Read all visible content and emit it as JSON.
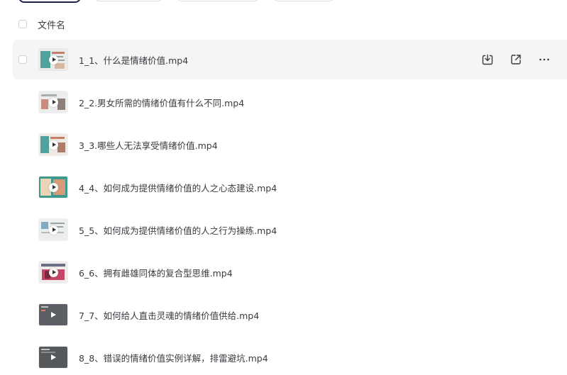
{
  "header": {
    "column_label": "文件名"
  },
  "files": [
    {
      "name": "1_1、什么是情绪价值.mp4",
      "thumb": "light",
      "hovered": true
    },
    {
      "name": "2_2.男女所需的情绪价值有什么不同.mp4",
      "thumb": "light"
    },
    {
      "name": "3_3.哪些人无法享受情绪价值.mp4",
      "thumb": "light"
    },
    {
      "name": "4_4、如何成为提供情绪价值的人之心态建设.mp4",
      "thumb": "teal"
    },
    {
      "name": "5_5、如何成为提供情绪价值的人之行为操练.mp4",
      "thumb": "light"
    },
    {
      "name": "6_6、拥有雌雄同体的复合型思维.mp4",
      "thumb": "pink"
    },
    {
      "name": "7_7、如何给人直击灵魂的情绪价值供给.mp4",
      "thumb": "dark"
    },
    {
      "name": "8_8、错误的情绪价值实例详解，排雷避坑.mp4",
      "thumb": "dark"
    }
  ],
  "row_actions": [
    "download-icon",
    "share-icon",
    "more-icon"
  ],
  "colors": {
    "hover_row": "#f5f5f6",
    "text": "#3a3b40",
    "toolbar_primary_border": "#1f2247"
  }
}
